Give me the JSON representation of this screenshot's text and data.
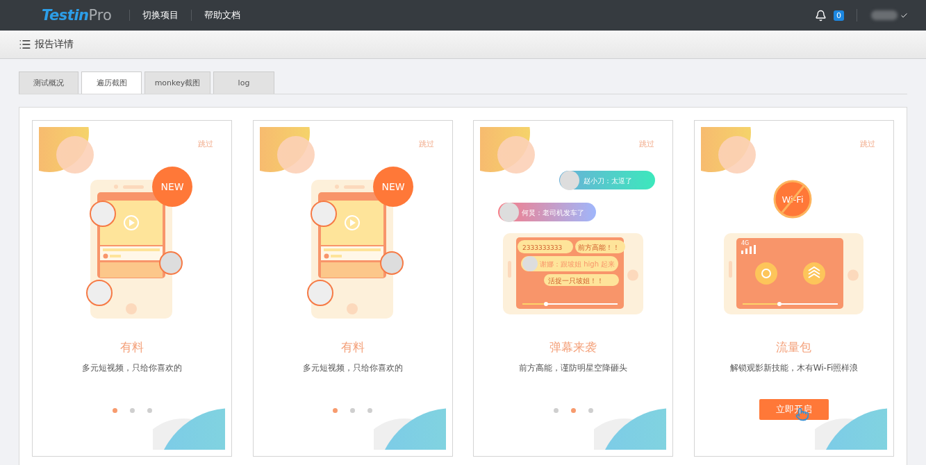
{
  "header": {
    "logo": {
      "brand": "Testin",
      "suffix": "Pro"
    },
    "nav": [
      "切换项目",
      "帮助文档"
    ],
    "notifications": "0"
  },
  "page_title": "报告详情",
  "tabs": [
    {
      "label": "测试概况",
      "selected": false
    },
    {
      "label": "遍历截图",
      "selected": true
    },
    {
      "label": "monkey截图",
      "selected": false
    },
    {
      "label": "log",
      "selected": false
    }
  ],
  "screens": [
    {
      "kind": "video",
      "skip": "跳过",
      "badge": "NEW",
      "title": "有料",
      "subtitle": "多元短视频，只给你喜欢的",
      "dots": [
        {
          "selected": true
        },
        {
          "selected": false
        },
        {
          "selected": false
        }
      ]
    },
    {
      "kind": "video",
      "skip": "跳过",
      "badge": "NEW",
      "title": "有料",
      "subtitle": "多元短视频，只给你喜欢的",
      "dots": [
        {
          "selected": true
        },
        {
          "selected": false
        },
        {
          "selected": false
        }
      ]
    },
    {
      "kind": "danmaku",
      "skip": "跳过",
      "bubbles": [
        "赵小刀：太逗了",
        "何炅：老司机发车了",
        "2333333333",
        "前方高能！！",
        "谢娜：跟坡姐 high 起来",
        "活捉一只坡姐！！"
      ],
      "title": "弹幕来袭",
      "subtitle": "前方高能，谨防明星空降砸头",
      "dots": [
        {
          "selected": false
        },
        {
          "selected": true
        },
        {
          "selected": false
        }
      ]
    },
    {
      "kind": "traffic",
      "skip": "跳过",
      "badge": "Wi-Fi",
      "signal": "4G",
      "title": "流量包",
      "subtitle": "解锁观影新技能，木有Wi-Fi照样浪",
      "button": "立即开启"
    }
  ]
}
